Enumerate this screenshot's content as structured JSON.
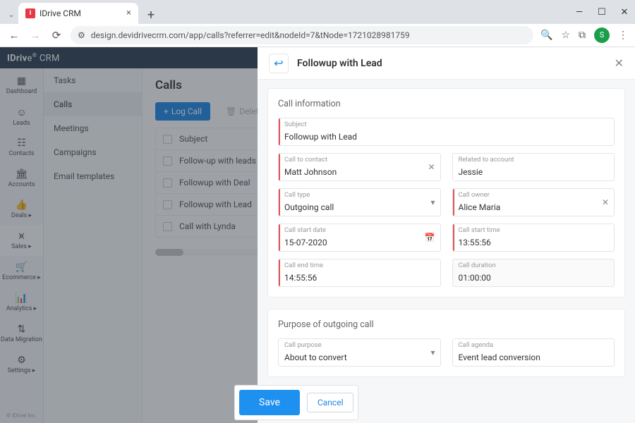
{
  "browser": {
    "tab_title": "IDrive CRM",
    "url": "design.devidrivecrm.com/app/calls?referrer=edit&nodeId=7&tNode=1721028981759",
    "avatar_letter": "S"
  },
  "brand": "IDrive® CRM",
  "leftnav": [
    {
      "label": "Dashboard",
      "icon": "▦"
    },
    {
      "label": "Leads",
      "icon": "☺"
    },
    {
      "label": "Contacts",
      "icon": "☷"
    },
    {
      "label": "Accounts",
      "icon": "🏛"
    },
    {
      "label": "Deals ▸",
      "icon": "👍"
    },
    {
      "label": "Sales ▸",
      "icon": "⩙",
      "active": true
    },
    {
      "label": "Ecommerce ▸",
      "icon": "🛒"
    },
    {
      "label": "Analytics ▸",
      "icon": "📊"
    },
    {
      "label": "Data Migration",
      "icon": "⇅"
    },
    {
      "label": "Settings ▸",
      "icon": "⚙"
    }
  ],
  "footer_text": "© IDrive Inc.",
  "subnav": [
    "Tasks",
    "Calls",
    "Meetings",
    "Campaigns",
    "Email templates"
  ],
  "subnav_active": "Calls",
  "page_title": "Calls",
  "toolbar": {
    "log": "Log Call",
    "delete": "Delete"
  },
  "table": {
    "header": "Subject",
    "rows": [
      "Follow-up with leads fro",
      "Followup with Deal",
      "Followup with Lead",
      "Call with Lynda"
    ]
  },
  "panel": {
    "title": "Followup with Lead",
    "section1": "Call information",
    "section2": "Purpose of outgoing call",
    "labels": {
      "subject": "Subject",
      "contact": "Call to contact",
      "account": "Related to account",
      "type": "Call type",
      "owner": "Call owner",
      "sdate": "Call start date",
      "stime": "Call start time",
      "etime": "Call end time",
      "dur": "Call duration",
      "purpose": "Call purpose",
      "agenda": "Call agenda"
    },
    "values": {
      "subject": "Followup with Lead",
      "contact": "Matt Johnson",
      "account": "Jessie",
      "type": "Outgoing call",
      "owner": "Alice Maria",
      "sdate": "15-07-2020",
      "stime": "13:55:56",
      "etime": "14:55:56",
      "dur": "01:00:00",
      "purpose": "About to convert",
      "agenda": "Event lead conversion"
    },
    "save": "Save",
    "cancel": "Cancel"
  }
}
